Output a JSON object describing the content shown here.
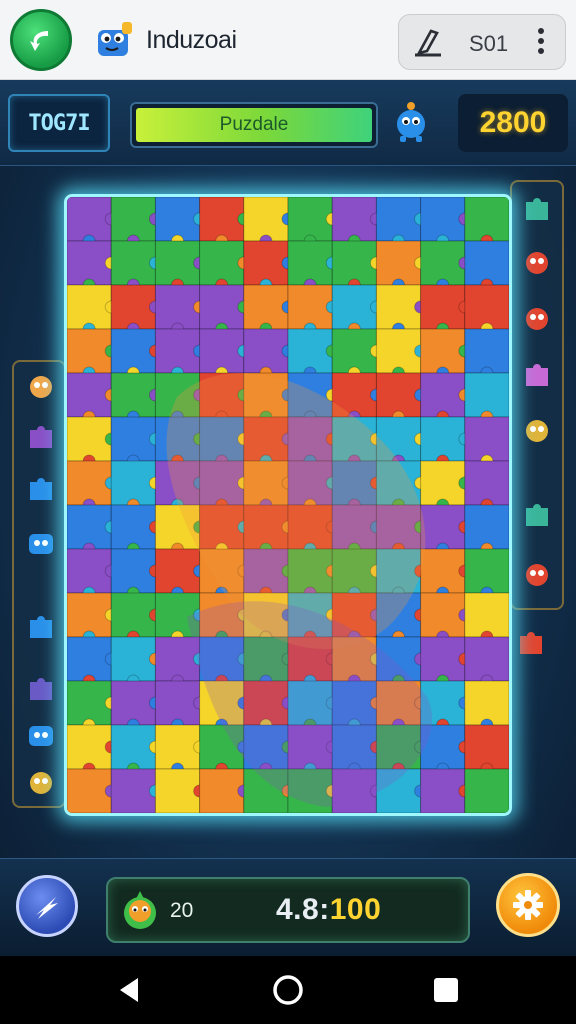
{
  "app": {
    "title": "Induzoai",
    "pill_label": "S01"
  },
  "hud": {
    "level_badge": "TOG7I",
    "progress_label": "Puzdale",
    "progress_fraction": 1.0,
    "score": "2800"
  },
  "status": {
    "count": "20",
    "timer_main": "4.8:",
    "timer_total": "100"
  },
  "icons": {
    "back": "back-arrow-icon",
    "logo": "blue-mascot-icon",
    "pill": "pen-icon",
    "menu": "kebab-menu-icon",
    "mascot": "blue-creature-icon",
    "hint": "lightning-icon",
    "avatar": "green-creature-icon",
    "settings": "gear-icon"
  },
  "colors": {
    "board_glow": "#9ff8ff",
    "score_yellow": "#ffd431",
    "piece_palette": [
      "#2f7fe0",
      "#36b54a",
      "#e2452f",
      "#8a4fc6",
      "#f5d52a",
      "#f08a2a",
      "#2ab3d6"
    ]
  }
}
